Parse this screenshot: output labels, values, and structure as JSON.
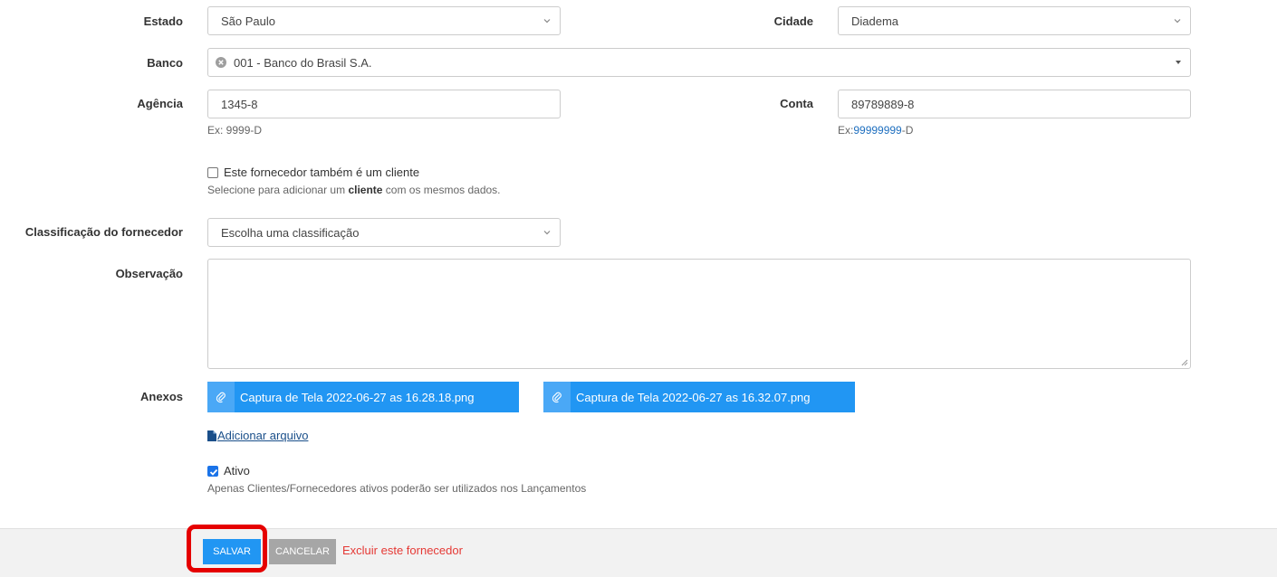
{
  "form": {
    "estado": {
      "label": "Estado",
      "value": "São Paulo"
    },
    "cidade": {
      "label": "Cidade",
      "value": "Diadema"
    },
    "banco": {
      "label": "Banco",
      "value": "001 - Banco do Brasil S.A."
    },
    "agencia": {
      "label": "Agência",
      "value": "1345-8",
      "help": "Ex: 9999-D"
    },
    "conta": {
      "label": "Conta",
      "value": "89789889-8",
      "help_prefix": "Ex:",
      "help_digits": "99999999",
      "help_suffix": "-D"
    },
    "cliente_check": {
      "label": "Este fornecedor também é um cliente",
      "help_before": "Selecione para adicionar um ",
      "help_bold": "cliente",
      "help_after": " com os mesmos dados.",
      "checked": false
    },
    "classificacao": {
      "label": "Classificação do fornecedor",
      "value": "Escolha uma classificação"
    },
    "observacao": {
      "label": "Observação",
      "value": ""
    },
    "anexos": {
      "label": "Anexos",
      "files": [
        "Captura de Tela 2022-06-27 as 16.28.18.png",
        "Captura de Tela 2022-06-27 as 16.32.07.png"
      ],
      "add_label": "Adicionar arquivo"
    },
    "ativo": {
      "label": "Ativo",
      "help": "Apenas Clientes/Fornecedores ativos poderão ser utilizados nos Lançamentos",
      "checked": true
    }
  },
  "footer": {
    "save_label": "SALVAR",
    "cancel_label": "CANCELAR",
    "delete_label": "Excluir este fornecedor"
  },
  "colors": {
    "primary": "#2196f3",
    "danger": "#e53935",
    "highlight": "#e50000",
    "muted_button": "#a6a6a6"
  }
}
